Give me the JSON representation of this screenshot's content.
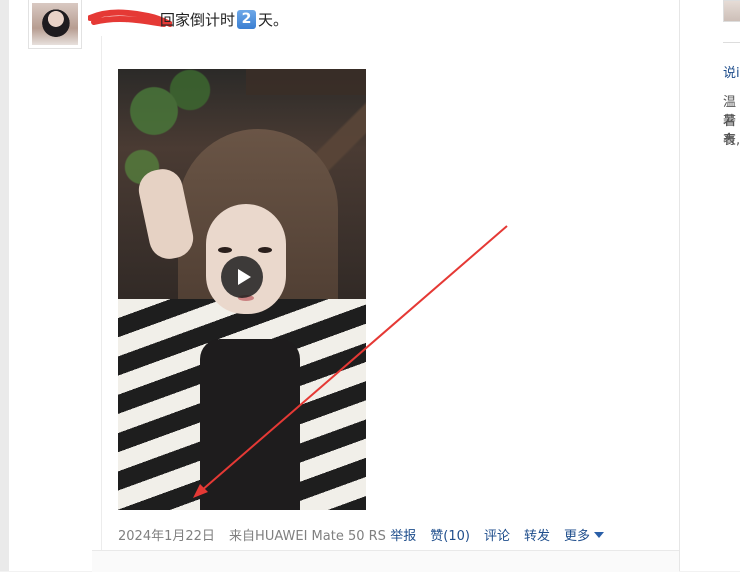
{
  "post": {
    "username_redacted": true,
    "text_before": "回家倒计时",
    "countdown_digit": "2",
    "text_after": "天。",
    "date": "2024年1月22日",
    "source": "来自HUAWEI Mate 50 RS"
  },
  "actions": {
    "report": "举报",
    "like": "赞(10)",
    "comment": "评论",
    "repost": "转发",
    "more": "更多"
  },
  "comment_preview": "...",
  "right_panel": {
    "link_label": "说i",
    "line1": "温暑",
    "line2": "若有",
    "line3": "表,"
  },
  "colors": {
    "link": "#1f4e8c",
    "annotation_arrow": "#e53935"
  },
  "icons": [
    "play-icon",
    "chevron-down-icon"
  ]
}
